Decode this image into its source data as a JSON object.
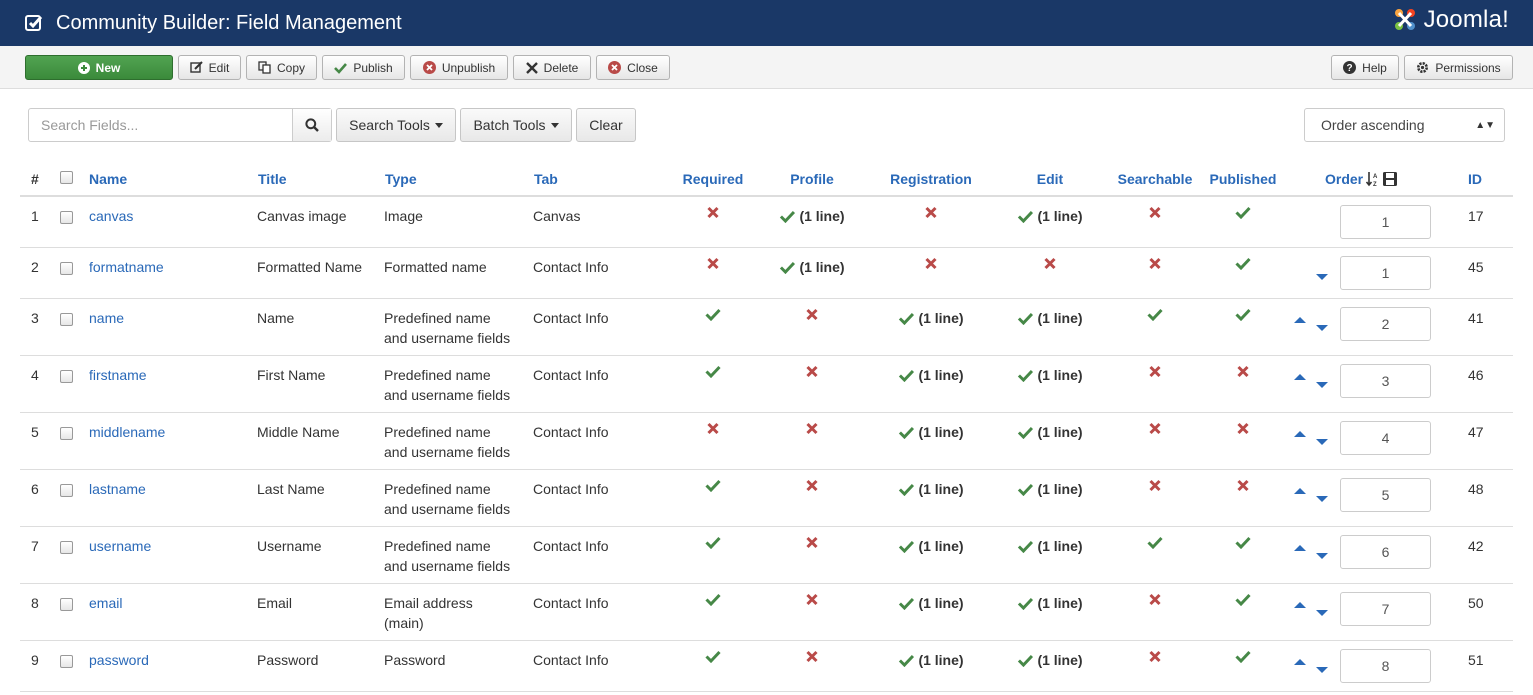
{
  "header": {
    "title": "Community Builder: Field Management",
    "brand": "Joomla!"
  },
  "toolbar": {
    "new": "New",
    "edit": "Edit",
    "copy": "Copy",
    "publish": "Publish",
    "unpublish": "Unpublish",
    "delete": "Delete",
    "close": "Close",
    "help": "Help",
    "permissions": "Permissions"
  },
  "filters": {
    "search_placeholder": "Search Fields...",
    "search_tools": "Search Tools",
    "batch_tools": "Batch Tools",
    "clear": "Clear",
    "order_select": "Order ascending"
  },
  "columns": {
    "num": "#",
    "name": "Name",
    "title": "Title",
    "type": "Type",
    "tab": "Tab",
    "required": "Required",
    "profile": "Profile",
    "registration": "Registration",
    "edit": "Edit",
    "searchable": "Searchable",
    "published": "Published",
    "order": "Order",
    "id": "ID"
  },
  "status_label": "(1 line)",
  "colors": {
    "yes": "#468847",
    "no": "#b94a48",
    "link": "#2a69b8",
    "header": "#1a3867"
  },
  "rows": [
    {
      "num": "1",
      "name": "canvas",
      "title": "Canvas image",
      "type1": "Image",
      "type2": "",
      "tab": "Canvas",
      "required": "no",
      "profile": "line",
      "registration": "no",
      "edit": "line",
      "searchable": "no",
      "published": "yes",
      "order": "1",
      "id": "17",
      "up": false,
      "down": false
    },
    {
      "num": "2",
      "name": "formatname",
      "title": "Formatted Name",
      "type1": "Formatted name",
      "type2": "",
      "tab": "Contact Info",
      "required": "no",
      "profile": "line",
      "registration": "no",
      "edit": "no",
      "searchable": "no",
      "published": "yes",
      "order": "1",
      "id": "45",
      "up": false,
      "down": true
    },
    {
      "num": "3",
      "name": "name",
      "title": "Name",
      "type1": "Predefined name",
      "type2": "and username fields",
      "tab": "Contact Info",
      "required": "yes",
      "profile": "no",
      "registration": "line",
      "edit": "line",
      "searchable": "yes",
      "published": "yes",
      "order": "2",
      "id": "41",
      "up": true,
      "down": true
    },
    {
      "num": "4",
      "name": "firstname",
      "title": "First Name",
      "type1": "Predefined name",
      "type2": "and username fields",
      "tab": "Contact Info",
      "required": "yes",
      "profile": "no",
      "registration": "line",
      "edit": "line",
      "searchable": "no",
      "published": "no",
      "order": "3",
      "id": "46",
      "up": true,
      "down": true
    },
    {
      "num": "5",
      "name": "middlename",
      "title": "Middle Name",
      "type1": "Predefined name",
      "type2": "and username fields",
      "tab": "Contact Info",
      "required": "no",
      "profile": "no",
      "registration": "line",
      "edit": "line",
      "searchable": "no",
      "published": "no",
      "order": "4",
      "id": "47",
      "up": true,
      "down": true
    },
    {
      "num": "6",
      "name": "lastname",
      "title": "Last Name",
      "type1": "Predefined name",
      "type2": "and username fields",
      "tab": "Contact Info",
      "required": "yes",
      "profile": "no",
      "registration": "line",
      "edit": "line",
      "searchable": "no",
      "published": "no",
      "order": "5",
      "id": "48",
      "up": true,
      "down": true
    },
    {
      "num": "7",
      "name": "username",
      "title": "Username",
      "type1": "Predefined name",
      "type2": "and username fields",
      "tab": "Contact Info",
      "required": "yes",
      "profile": "no",
      "registration": "line",
      "edit": "line",
      "searchable": "yes",
      "published": "yes",
      "order": "6",
      "id": "42",
      "up": true,
      "down": true
    },
    {
      "num": "8",
      "name": "email",
      "title": "Email",
      "type1": "Email address",
      "type2": "(main)",
      "tab": "Contact Info",
      "required": "yes",
      "profile": "no",
      "registration": "line",
      "edit": "line",
      "searchable": "no",
      "published": "yes",
      "order": "7",
      "id": "50",
      "up": true,
      "down": true
    },
    {
      "num": "9",
      "name": "password",
      "title": "Password",
      "type1": "Password",
      "type2": "",
      "tab": "Contact Info",
      "required": "yes",
      "profile": "no",
      "registration": "line",
      "edit": "line",
      "searchable": "no",
      "published": "yes",
      "order": "8",
      "id": "51",
      "up": true,
      "down": true
    }
  ]
}
